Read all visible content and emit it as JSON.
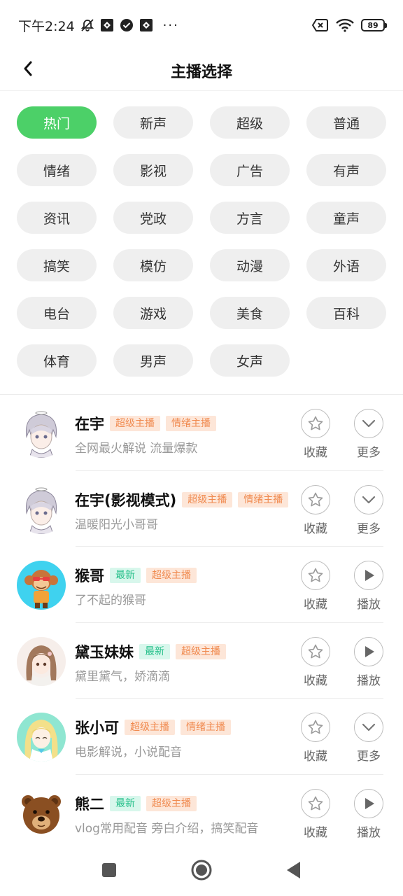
{
  "status_bar": {
    "time": "下午2:24",
    "dots": "···",
    "battery": "89",
    "icons": [
      "alarm-off-icon",
      "app-notification-icon",
      "check-circle-icon",
      "app-notification-icon",
      "sim-off-icon",
      "wifi-icon",
      "battery-icon"
    ]
  },
  "header": {
    "title": "主播选择",
    "back_icon": "chevron-left-icon"
  },
  "categories": [
    "热门",
    "新声",
    "超级",
    "普通",
    "情绪",
    "影视",
    "广告",
    "有声",
    "资讯",
    "党政",
    "方言",
    "童声",
    "搞笑",
    "模仿",
    "动漫",
    "外语",
    "电台",
    "游戏",
    "美食",
    "百科",
    "体育",
    "男声",
    "女声"
  ],
  "active_category": "热门",
  "anchors": [
    {
      "name": "在宇",
      "tags": [
        {
          "text": "超级主播",
          "style": "orange"
        },
        {
          "text": "情绪主播",
          "style": "orange"
        }
      ],
      "desc": "全网最火解说 流量爆款",
      "fav_label": "收藏",
      "action_label": "更多",
      "action_icon": "chevron-down-icon",
      "avatar": "anime-boy-avatar"
    },
    {
      "name": "在宇(影视模式)",
      "tags": [
        {
          "text": "超级主播",
          "style": "orange"
        },
        {
          "text": "情绪主播",
          "style": "orange"
        }
      ],
      "desc": "温暖阳光小哥哥",
      "fav_label": "收藏",
      "action_label": "更多",
      "action_icon": "chevron-down-icon",
      "avatar": "anime-boy-avatar"
    },
    {
      "name": "猴哥",
      "tags": [
        {
          "text": "最新",
          "style": "green"
        },
        {
          "text": "超级主播",
          "style": "orange"
        }
      ],
      "desc": "了不起的猴哥",
      "fav_label": "收藏",
      "action_label": "播放",
      "action_icon": "play-icon",
      "avatar": "monkey-avatar"
    },
    {
      "name": "黛玉妹妹",
      "tags": [
        {
          "text": "最新",
          "style": "green"
        },
        {
          "text": "超级主播",
          "style": "orange"
        }
      ],
      "desc": "黛里黛气，娇滴滴",
      "fav_label": "收藏",
      "action_label": "播放",
      "action_icon": "play-icon",
      "avatar": "anime-girl-avatar"
    },
    {
      "name": "张小可",
      "tags": [
        {
          "text": "超级主播",
          "style": "orange"
        },
        {
          "text": "情绪主播",
          "style": "orange"
        }
      ],
      "desc": "电影解说，小说配音",
      "fav_label": "收藏",
      "action_label": "更多",
      "action_icon": "chevron-down-icon",
      "avatar": "blonde-girl-avatar"
    },
    {
      "name": "熊二",
      "tags": [
        {
          "text": "最新",
          "style": "green"
        },
        {
          "text": "超级主播",
          "style": "orange"
        }
      ],
      "desc": "vlog常用配音 旁白介绍，搞笑配音",
      "fav_label": "收藏",
      "action_label": "播放",
      "action_icon": "play-icon",
      "avatar": "bear-avatar"
    }
  ],
  "colors": {
    "accent": "#4cd068",
    "tag_orange_bg": "#fde6d8",
    "tag_orange_text": "#f08a4f",
    "tag_green_bg": "#d8f7ec",
    "tag_green_text": "#27c08b",
    "chip_bg": "#efefef"
  },
  "nav_bar": [
    "square-icon",
    "home-circle-icon",
    "back-triangle-icon"
  ]
}
